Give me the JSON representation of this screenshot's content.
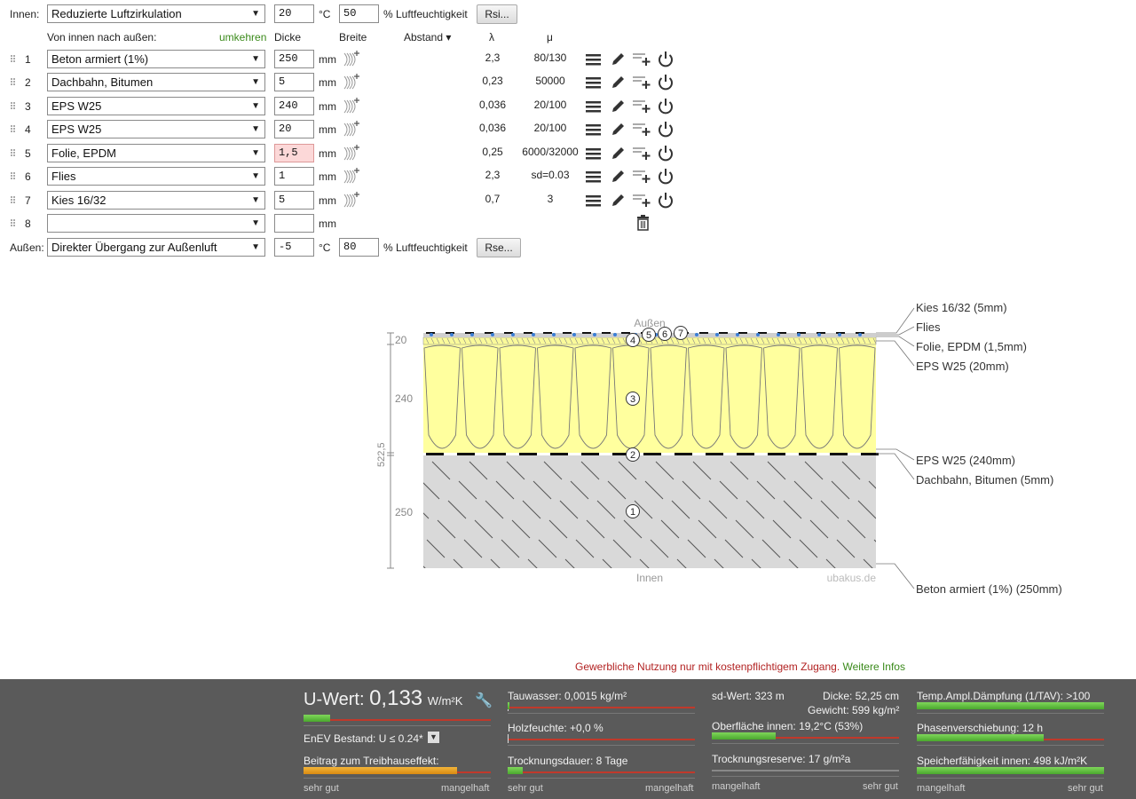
{
  "inside": {
    "label": "Innen:",
    "select": "Reduzierte Luftzirkulation",
    "temp": "20",
    "temp_unit": "°C",
    "humidity": "50",
    "humidity_unit": "% Luftfeuchtigkeit",
    "button": "Rsi..."
  },
  "columns": {
    "direction": "Von innen nach außen:",
    "reverse": "umkehren",
    "thickness": "Dicke",
    "width": "Breite",
    "distance": "Abstand ▾",
    "lambda": "λ",
    "mu": "μ"
  },
  "layers": [
    {
      "num": "1",
      "material": "Beton armiert (1%)",
      "thickness": "250",
      "unit": "mm",
      "lambda": "2,3",
      "mu": "80/130",
      "error": false
    },
    {
      "num": "2",
      "material": "Dachbahn, Bitumen",
      "thickness": "5",
      "unit": "mm",
      "lambda": "0,23",
      "mu": "50000",
      "error": false
    },
    {
      "num": "3",
      "material": "EPS W25",
      "thickness": "240",
      "unit": "mm",
      "lambda": "0,036",
      "mu": "20/100",
      "error": false
    },
    {
      "num": "4",
      "material": "EPS W25",
      "thickness": "20",
      "unit": "mm",
      "lambda": "0,036",
      "mu": "20/100",
      "error": false
    },
    {
      "num": "5",
      "material": "Folie, EPDM",
      "thickness": "1,5",
      "unit": "mm",
      "lambda": "0,25",
      "mu": "6000/32000",
      "error": true
    },
    {
      "num": "6",
      "material": "Flies",
      "thickness": "1",
      "unit": "mm",
      "lambda": "2,3",
      "mu": "sd=0.03",
      "error": false
    },
    {
      "num": "7",
      "material": "Kies 16/32",
      "thickness": "5",
      "unit": "mm",
      "lambda": "0,7",
      "mu": "3",
      "error": false
    },
    {
      "num": "8",
      "material": "",
      "thickness": "",
      "unit": "mm",
      "lambda": "",
      "mu": "",
      "error": false
    }
  ],
  "outside": {
    "label": "Außen:",
    "select": "Direkter Übergang zur Außenluft",
    "temp": "-5",
    "temp_unit": "°C",
    "humidity": "80",
    "humidity_unit": "% Luftfeuchtigkeit",
    "button": "Rse..."
  },
  "diagram": {
    "top_label": "Außen",
    "bottom_label": "Innen",
    "watermark": "ubakus.de",
    "dim_total": "522,5",
    "dims": [
      "20",
      "240",
      "250"
    ],
    "callouts_top": [
      "Kies 16/32 (5mm)",
      "Flies",
      "Folie, EPDM (1,5mm)",
      "EPS W25 (20mm)"
    ],
    "callouts_mid": [
      "EPS W25 (240mm)",
      "Dachbahn, Bitumen (5mm)"
    ],
    "callouts_bottom": [
      "Beton armiert (1%) (250mm)"
    ],
    "markers": [
      "1",
      "2",
      "3",
      "4",
      "5",
      "6",
      "7"
    ]
  },
  "notice": {
    "text": "Gewerbliche Nutzung nur mit kostenpflichtigem Zugang.",
    "link": "Weitere Infos"
  },
  "results": {
    "u_label": "U-Wert:",
    "u_value": "0,133",
    "u_unit": "W/m²K",
    "u_fill": 0.14,
    "enev": "EnEV Bestand: U ≤ 0.24*",
    "greenhouse": "Beitrag zum Treibhauseffekt:",
    "greenhouse_fill": 0.82,
    "tauwasser": "Tauwasser: 0,0015 kg/m²",
    "tauwasser_fill": 0.01,
    "holz": "Holzfeuchte: +0,0 %",
    "holz_fill": 0.0,
    "trocknung": "Trocknungsdauer: 8 Tage",
    "trocknung_fill": 0.08,
    "sd": "sd-Wert: 323 m",
    "dicke": "Dicke: 52,25 cm",
    "gewicht": "Gewicht: 599 kg/m²",
    "oberflaeche": "Oberfläche innen: 19,2°C (53%)",
    "oberflaeche_fill": 0.34,
    "reserve": "Trocknungsreserve: 17 g/m²a",
    "reserve_fill": 0.0,
    "tav": "Temp.Ampl.Dämpfung (1/TAV): >100",
    "tav_fill": 1.0,
    "phase": "Phasenverschiebung: 12 h",
    "phase_fill": 0.68,
    "speicher": "Speicherfähigkeit innen: 498 kJ/m²K",
    "speicher_fill": 1.0,
    "good": "sehr gut",
    "bad": "mangelhaft"
  },
  "colors": {
    "reverse_link": "#3a8a1a",
    "notice_text": "#b22222",
    "notice_link": "#3a8a1a",
    "bottom_bg": "#5a5a5a",
    "insulation": "#ffff9e",
    "concrete": "#d9d9d9"
  }
}
